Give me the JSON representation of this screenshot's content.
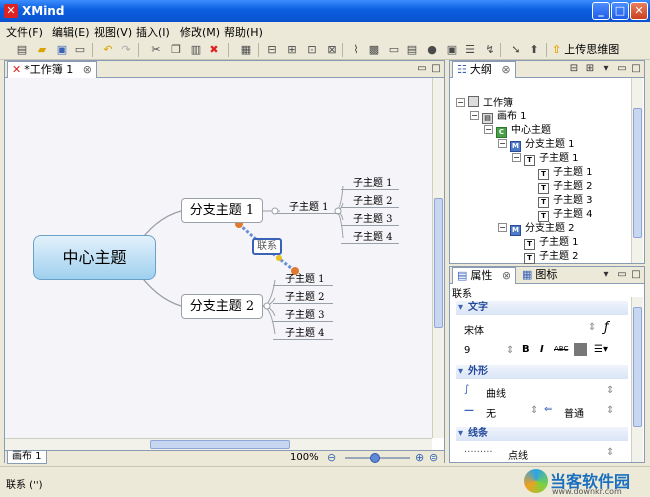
{
  "window": {
    "title": "XMind"
  },
  "menus": [
    "文件(F)",
    "编辑(E)",
    "视图(V)",
    "插入(I)",
    "修改(M)",
    "帮助(H)"
  ],
  "toolbar": {
    "upload_label": "上传思维图"
  },
  "editor": {
    "tab_label": "*工作簿 1",
    "sheet_tab": "画布 1",
    "zoom": "100%"
  },
  "mindmap": {
    "central": "中心主题",
    "branches": [
      {
        "label": "分支主题 1",
        "children": [
          "子主题 1",
          "子主题 2",
          "子主题 3",
          "子主题 4"
        ],
        "inline_child": "子主题 1"
      },
      {
        "label": "分支主题 2",
        "children": [
          "子主题 1",
          "子主题 2",
          "子主题 3",
          "子主题 4"
        ]
      }
    ],
    "relationship_label": "联系"
  },
  "outline": {
    "tab_label": "大纲",
    "rows": [
      {
        "label": "工作簿"
      },
      {
        "label": "画布 1"
      },
      {
        "label": "中心主题"
      },
      {
        "label": "分支主题 1"
      },
      {
        "label": "子主题 1"
      },
      {
        "label": "子主题 1"
      },
      {
        "label": "子主题 2"
      },
      {
        "label": "子主题 3"
      },
      {
        "label": "子主题 4"
      },
      {
        "label": "分支主题 2"
      },
      {
        "label": "子主题 1"
      },
      {
        "label": "子主题 2"
      }
    ]
  },
  "properties": {
    "tab_label": "属性",
    "icons_tab_label": "图标",
    "context": "联系",
    "text_section": "文字",
    "font_name": "宋体",
    "font_size": "9",
    "shape_section": "外形",
    "curve_label": "曲线",
    "start_label": "无",
    "end_label": "普通",
    "line_section": "线条",
    "line_style": "点线"
  },
  "status": {
    "text": "联系 ('')"
  },
  "watermark": {
    "title": "当客软件园",
    "url": "www.downkr.com"
  },
  "colors": {
    "central_fill": "#9fd0ef",
    "relation_stroke": "#3a63b8",
    "title_bar": "#0b5fe0"
  }
}
